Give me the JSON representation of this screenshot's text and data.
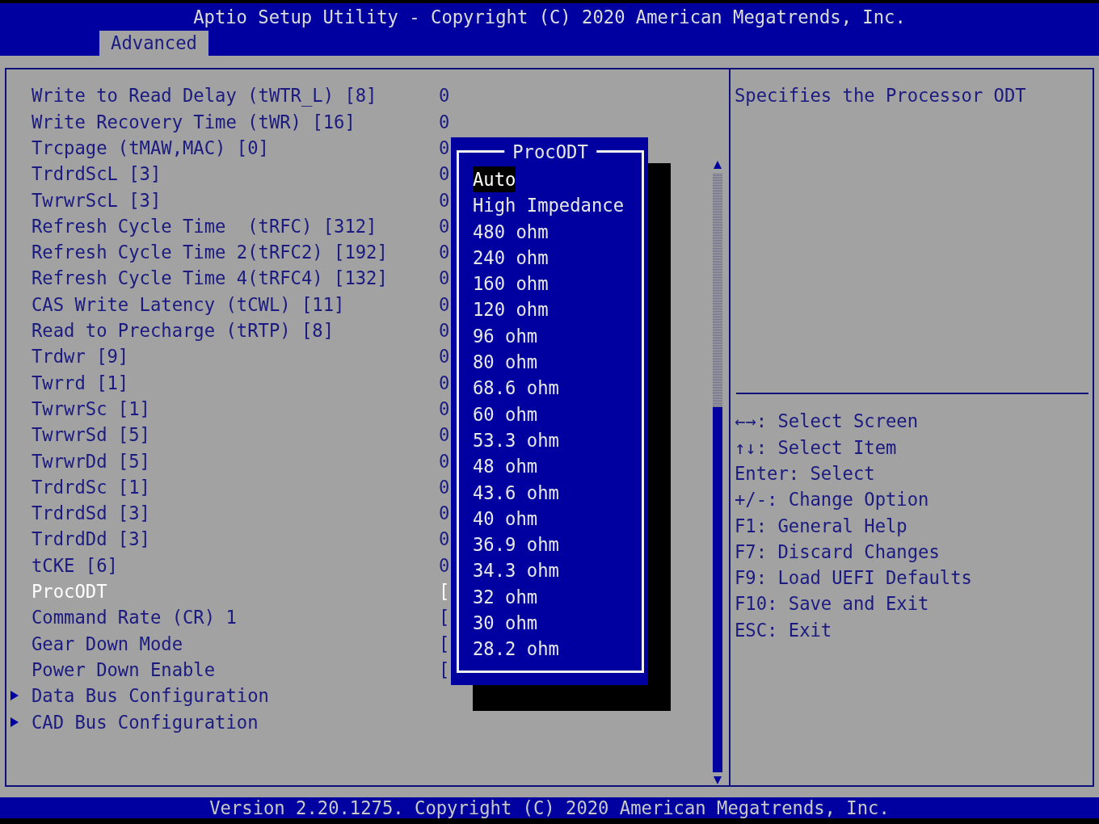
{
  "window": {
    "title": "Aptio Setup Utility - Copyright (C) 2020 American Megatrends, Inc."
  },
  "tabs": [
    {
      "label": "Advanced",
      "selected": true
    }
  ],
  "settings": [
    {
      "kind": "setting",
      "label": "Write to Read Delay (tWTR_L) [8]",
      "value": "0",
      "selected": false
    },
    {
      "kind": "setting",
      "label": "Write Recovery Time (tWR) [16]",
      "value": "0",
      "selected": false
    },
    {
      "kind": "setting",
      "label": "Trcpage (tMAW,MAC) [0]",
      "value": "0",
      "selected": false
    },
    {
      "kind": "setting",
      "label": "TrdrdScL [3]",
      "value": "0",
      "selected": false
    },
    {
      "kind": "setting",
      "label": "TwrwrScL [3]",
      "value": "0",
      "selected": false
    },
    {
      "kind": "setting",
      "label": "Refresh Cycle Time  (tRFC) [312]",
      "value": "0",
      "selected": false
    },
    {
      "kind": "setting",
      "label": "Refresh Cycle Time 2(tRFC2) [192]",
      "value": "0",
      "selected": false
    },
    {
      "kind": "setting",
      "label": "Refresh Cycle Time 4(tRFC4) [132]",
      "value": "0",
      "selected": false
    },
    {
      "kind": "setting",
      "label": "CAS Write Latency (tCWL) [11]",
      "value": "0",
      "selected": false
    },
    {
      "kind": "setting",
      "label": "Read to Precharge (tRTP) [8]",
      "value": "0",
      "selected": false
    },
    {
      "kind": "setting",
      "label": "Trdwr [9]",
      "value": "0",
      "selected": false
    },
    {
      "kind": "setting",
      "label": "Twrrd [1]",
      "value": "0",
      "selected": false
    },
    {
      "kind": "setting",
      "label": "TwrwrSc [1]",
      "value": "0",
      "selected": false
    },
    {
      "kind": "setting",
      "label": "TwrwrSd [5]",
      "value": "0",
      "selected": false
    },
    {
      "kind": "setting",
      "label": "TwrwrDd [5]",
      "value": "0",
      "selected": false
    },
    {
      "kind": "setting",
      "label": "TrdrdSc [1]",
      "value": "0",
      "selected": false
    },
    {
      "kind": "setting",
      "label": "TrdrdSd [3]",
      "value": "0",
      "selected": false
    },
    {
      "kind": "setting",
      "label": "TrdrdDd [3]",
      "value": "0",
      "selected": false
    },
    {
      "kind": "setting",
      "label": "tCKE [6]",
      "value": "0",
      "selected": false
    },
    {
      "kind": "setting",
      "label": "ProcODT",
      "value": "[",
      "selected": true
    },
    {
      "kind": "setting",
      "label": "Command Rate (CR) 1",
      "value": "[",
      "selected": false
    },
    {
      "kind": "setting",
      "label": "Gear Down Mode",
      "value": "[",
      "selected": false
    },
    {
      "kind": "setting",
      "label": "Power Down Enable",
      "value": "[",
      "selected": false
    },
    {
      "kind": "submenu",
      "label": "Data Bus Configuration",
      "selected": false
    },
    {
      "kind": "submenu",
      "label": "CAD Bus Configuration",
      "selected": false
    }
  ],
  "help": {
    "text": "Specifies the Processor ODT"
  },
  "keys": [
    "←→: Select Screen",
    "↑↓: Select Item",
    "Enter: Select",
    "+/-: Change Option",
    "F1: General Help",
    "F7: Discard Changes",
    "F9: Load UEFI Defaults",
    "F10: Save and Exit",
    "ESC: Exit"
  ],
  "popup": {
    "title": "ProcODT",
    "options": [
      {
        "label": "Auto",
        "selected": true
      },
      {
        "label": "High Impedance",
        "selected": false
      },
      {
        "label": "480 ohm",
        "selected": false
      },
      {
        "label": "240 ohm",
        "selected": false
      },
      {
        "label": "160 ohm",
        "selected": false
      },
      {
        "label": "120 ohm",
        "selected": false
      },
      {
        "label": "96 ohm",
        "selected": false
      },
      {
        "label": "80 ohm",
        "selected": false
      },
      {
        "label": "68.6 ohm",
        "selected": false
      },
      {
        "label": "60 ohm",
        "selected": false
      },
      {
        "label": "53.3 ohm",
        "selected": false
      },
      {
        "label": "48 ohm",
        "selected": false
      },
      {
        "label": "43.6 ohm",
        "selected": false
      },
      {
        "label": "40 ohm",
        "selected": false
      },
      {
        "label": "36.9 ohm",
        "selected": false
      },
      {
        "label": "34.3 ohm",
        "selected": false
      },
      {
        "label": "32 ohm",
        "selected": false
      },
      {
        "label": "30 ohm",
        "selected": false
      },
      {
        "label": "28.2 ohm",
        "selected": false
      }
    ]
  },
  "status_bar": "Version 2.20.1275. Copyright (C) 2020 American Megatrends, Inc."
}
